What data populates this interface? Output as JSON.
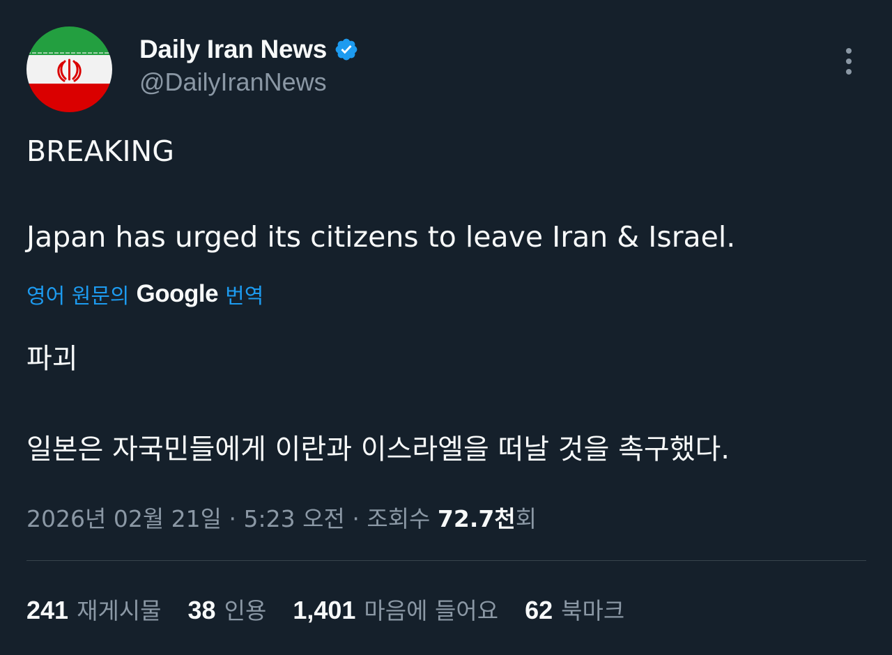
{
  "author": {
    "display_name": "Daily Iran News",
    "handle": "@DailyIranNews",
    "verified": true,
    "avatar_icon": "iran-flag-avatar"
  },
  "more_icon": "more-options-vertical-icon",
  "post": {
    "line1": "BREAKING",
    "line2": "Japan has urged its citizens to leave Iran & Israel."
  },
  "translation": {
    "prefix": "영어 원문의",
    "provider": "Google",
    "suffix": "번역",
    "line1": "파괴",
    "line2": "일본은 자국민들에게 이란과 이스라엘을 떠날 것을 촉구했다."
  },
  "meta": {
    "date": "2026년 02월 21일",
    "separator1": " · ",
    "time": "5:23 오전",
    "separator2": " · ",
    "views_label": "조회수",
    "views_count": "72.7천",
    "views_suffix": "회"
  },
  "stats": {
    "reposts_count": "241",
    "reposts_label": "재게시물",
    "quotes_count": "38",
    "quotes_label": "인용",
    "likes_count": "1,401",
    "likes_label": "마음에 들어요",
    "bookmarks_count": "62",
    "bookmarks_label": "북마크"
  },
  "colors": {
    "background": "#15202b",
    "text_primary": "#f7f9f9",
    "text_secondary": "#8b98a5",
    "accent": "#1d9bf0",
    "divider": "#38444d"
  }
}
